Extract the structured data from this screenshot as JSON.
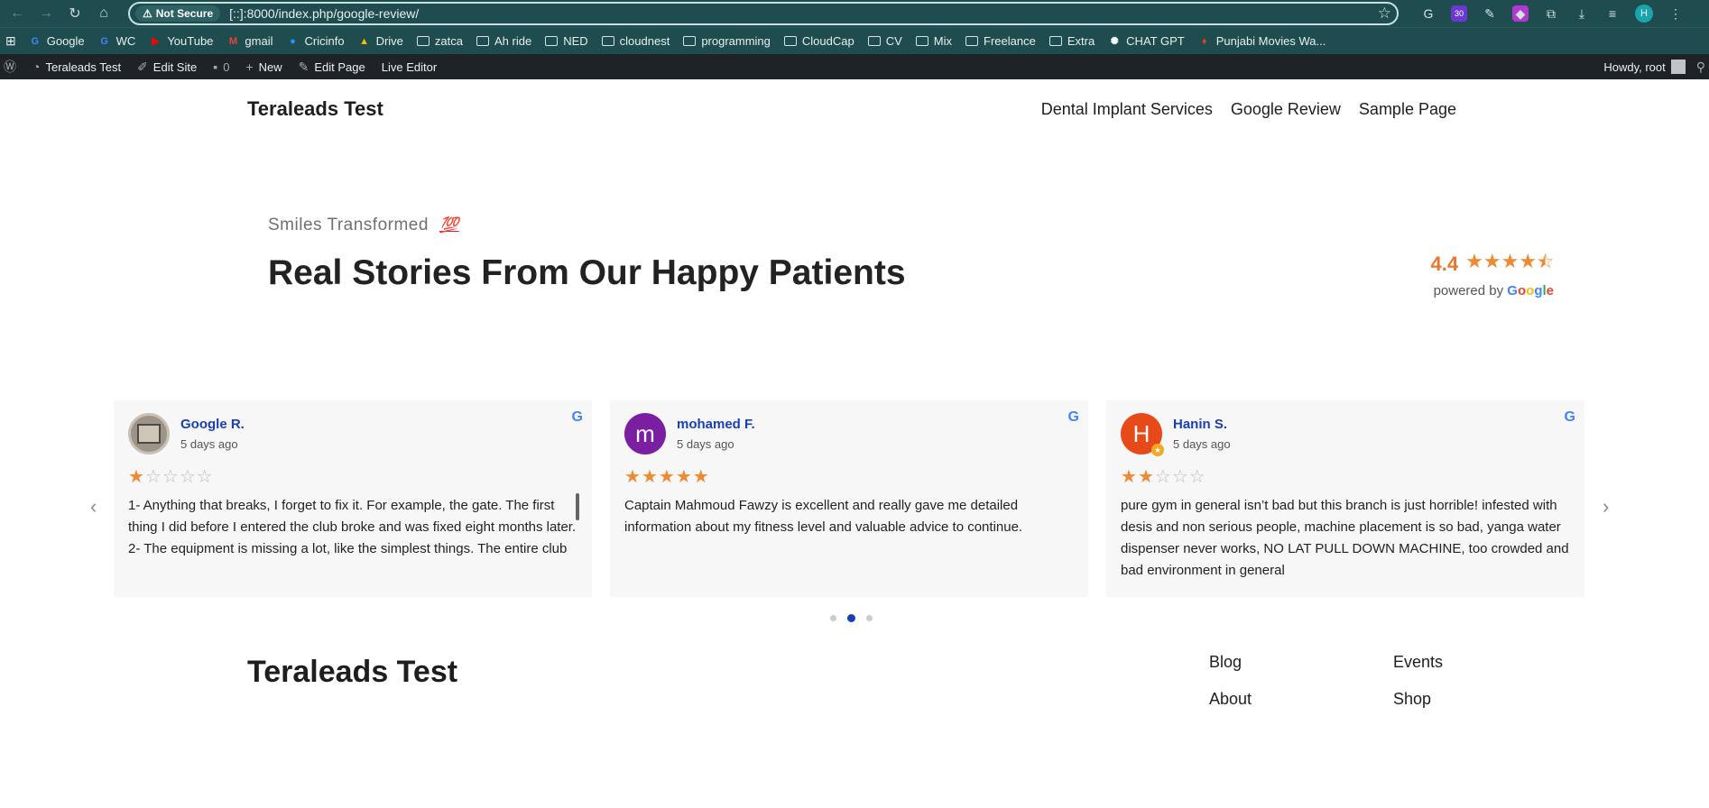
{
  "browser": {
    "not_secure_label": "Not Secure",
    "url": "[::]:8000/index.php/google-review/",
    "ext_badge": "30",
    "profile_initial": "H"
  },
  "bookmarks": [
    {
      "label": "Google",
      "icon": "google-icon"
    },
    {
      "label": "WC",
      "icon": "google-icon"
    },
    {
      "label": "YouTube",
      "icon": "youtube-icon"
    },
    {
      "label": "gmail",
      "icon": "gmail-icon"
    },
    {
      "label": "Cricinfo",
      "icon": "globe-icon"
    },
    {
      "label": "Drive",
      "icon": "drive-icon"
    },
    {
      "label": "zatca",
      "icon": "folder-icon"
    },
    {
      "label": "Ah ride",
      "icon": "folder-icon"
    },
    {
      "label": "NED",
      "icon": "folder-icon"
    },
    {
      "label": "cloudnest",
      "icon": "folder-icon"
    },
    {
      "label": "programming",
      "icon": "folder-icon"
    },
    {
      "label": "CloudCap",
      "icon": "folder-icon"
    },
    {
      "label": "CV",
      "icon": "folder-icon"
    },
    {
      "label": "Mix",
      "icon": "folder-icon"
    },
    {
      "label": "Freelance",
      "icon": "folder-icon"
    },
    {
      "label": "Extra",
      "icon": "folder-icon"
    },
    {
      "label": "CHAT GPT",
      "icon": "chatgpt-icon"
    },
    {
      "label": "Punjabi Movies Wa...",
      "icon": "movie-icon"
    }
  ],
  "wpbar": {
    "site": "Teraleads Test",
    "edit_site": "Edit Site",
    "comments": "0",
    "new": "New",
    "edit_page": "Edit Page",
    "live_editor": "Live Editor",
    "howdy": "Howdy, root"
  },
  "site": {
    "title": "Teraleads Test",
    "nav": [
      "Dental Implant Services",
      "Google Review",
      "Sample Page"
    ]
  },
  "hero": {
    "eyebrow": "Smiles Transformed",
    "emoji": "💯",
    "headline": "Real Stories From Our Happy Patients",
    "rating": "4.4",
    "rating_value": 4.4,
    "powered_by": "powered by"
  },
  "reviews": [
    {
      "name": "Google R.",
      "time": "5 days ago",
      "stars": 1,
      "text": "1- Anything that breaks, I forget to fix it. For example, the gate. The first thing I did before I entered the club broke and was fixed eight months later.\n2- The equipment is missing a lot, like the simplest things. The entire club"
    },
    {
      "name": "mohamed F.",
      "initial": "m",
      "time": "5 days ago",
      "stars": 5,
      "text": "Captain Mahmoud Fawzy is excellent and really gave me detailed information about my fitness level and valuable advice to continue."
    },
    {
      "name": "Hanin S.",
      "initial": "H",
      "time": "5 days ago",
      "stars": 2,
      "text": "pure gym in general isn’t bad but this branch is just horrible! infested with desis and non serious people, machine placement is so bad, yanga water dispenser never works, NO LAT PULL DOWN MACHINE, too crowded and bad environment in general"
    }
  ],
  "carousel": {
    "pages": 3,
    "active": 2
  },
  "footer": {
    "title": "Teraleads Test",
    "links": [
      "Blog",
      "Events",
      "About",
      "Shop"
    ]
  },
  "colors": {
    "chrome": "#1f4d4f",
    "wpbar": "#1d2327",
    "star": "#f08a32",
    "name_link": "#1a3eb5"
  }
}
